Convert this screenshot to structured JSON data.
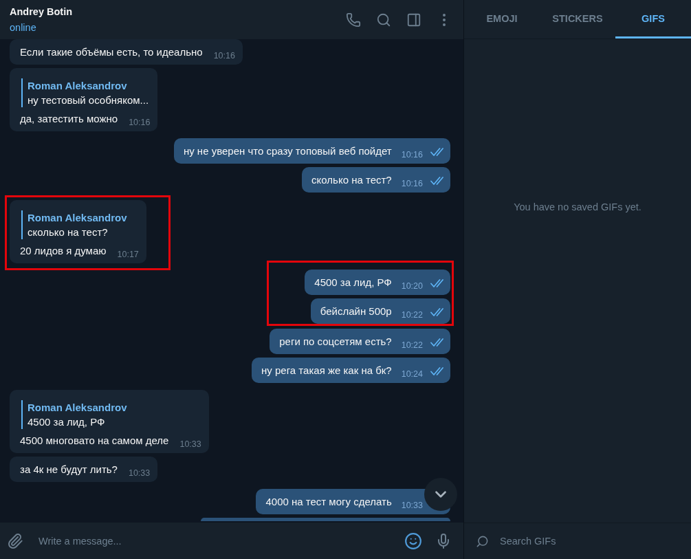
{
  "header": {
    "title": "Andrey Botin",
    "status": "online"
  },
  "messages": [
    {
      "kind": "message",
      "outgoing": false,
      "text": "Если такие объёмы есть, то идеально",
      "time": "10:16",
      "highlighted": false
    },
    {
      "kind": "message",
      "outgoing": false,
      "reply": {
        "author": "Roman Aleksandrov",
        "text": "ну тестовый особняком..."
      },
      "text": "да, затестить можно",
      "time": "10:16",
      "highlighted": false
    },
    {
      "kind": "message",
      "outgoing": true,
      "text": "ну не уверен что сразу топовый веб пойдет",
      "time": "10:16",
      "read": true,
      "highlighted": false
    },
    {
      "kind": "message",
      "outgoing": true,
      "text": "сколько на тест?",
      "time": "10:16",
      "read": true,
      "highlighted": false
    },
    {
      "kind": "message",
      "outgoing": false,
      "reply": {
        "author": "Roman Aleksandrov",
        "text": "сколько на тест?"
      },
      "text": "20 лидов я думаю",
      "time": "10:17",
      "highlighted": true
    },
    {
      "kind": "message",
      "outgoing": true,
      "text": "4500 за лид, РФ",
      "time": "10:20",
      "read": true,
      "highlighted": true
    },
    {
      "kind": "message",
      "outgoing": true,
      "text": "бейслайн 500р",
      "time": "10:22",
      "read": true,
      "highlighted": true
    },
    {
      "kind": "message",
      "outgoing": true,
      "text": "реги по соцсетям есть?",
      "time": "10:22",
      "read": true,
      "highlighted": false
    },
    {
      "kind": "message",
      "outgoing": true,
      "text": "ну рега такая же как на бк?",
      "time": "10:24",
      "read": true,
      "highlighted": false
    },
    {
      "kind": "message",
      "outgoing": false,
      "reply": {
        "author": "Roman Aleksandrov",
        "text": "4500 за лид, РФ"
      },
      "text": "4500 многовато на самом деле",
      "time": "10:33",
      "highlighted": false
    },
    {
      "kind": "message",
      "outgoing": false,
      "text": "за 4к не будут лить?",
      "time": "10:33",
      "highlighted": false
    },
    {
      "kind": "message",
      "outgoing": true,
      "text": "4000 на тест могу сделать",
      "time": "10:33",
      "highlighted": false
    },
    {
      "kind": "cut_off",
      "outgoing": true,
      "highlighted": false
    }
  ],
  "composer": {
    "placeholder": "Write a message..."
  },
  "panel": {
    "tabs": [
      {
        "label": "EMOJI",
        "selected": false
      },
      {
        "label": "STICKERS",
        "selected": false
      },
      {
        "label": "GIFS",
        "selected": true
      }
    ],
    "empty_text": "You have no saved GIFs yet.",
    "search": {
      "placeholder": "Search GIFs"
    }
  }
}
